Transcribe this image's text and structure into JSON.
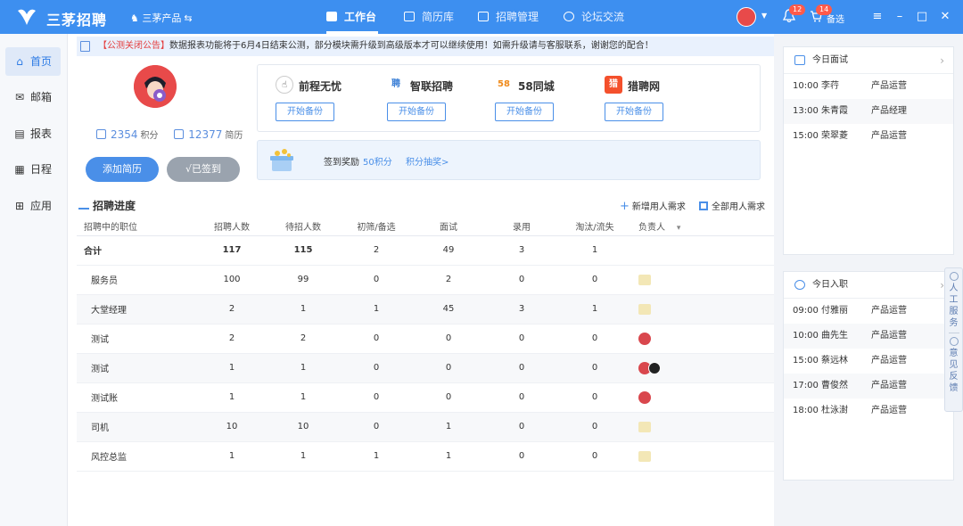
{
  "app": {
    "logo_text": "三茅招聘",
    "product_label": "三茅产品",
    "product_switch_icon": "switch-icon",
    "nav": [
      {
        "label": "工作台",
        "icon": "dashboard-icon",
        "active": true
      },
      {
        "label": "简历库",
        "icon": "resume-icon",
        "active": false
      },
      {
        "label": "招聘管理",
        "icon": "grid-icon",
        "active": false
      },
      {
        "label": "论坛交流",
        "icon": "chat-icon",
        "active": false
      }
    ],
    "bell_badge": "12",
    "cart_badge": "14",
    "cart_label": "备选",
    "colors": {
      "primary": "#3d8ff0",
      "accent": "#4a8fe8",
      "danger": "#e43c3c"
    }
  },
  "sidebar": {
    "items": [
      {
        "label": "首页",
        "icon": "home-icon"
      },
      {
        "label": "邮箱",
        "icon": "mail-icon"
      },
      {
        "label": "报表",
        "icon": "report-icon"
      },
      {
        "label": "日程",
        "icon": "calendar-icon"
      },
      {
        "label": "应用",
        "icon": "apps-icon"
      }
    ]
  },
  "notice": {
    "tag": "【公测关闭公告】",
    "text": "数据报表功能将于6月4日结束公测，部分模块需升级到高级版本才可以继续使用！如需升级请与客服联系，谢谢您的配合！"
  },
  "profile": {
    "points": "2354",
    "points_unit": "积分",
    "resumes": "12377",
    "resumes_unit": "简历",
    "add_button": "添加简历",
    "signed_button": "√已签到"
  },
  "partners": [
    {
      "name": "前程无忧",
      "logo": "51",
      "button": "开始备份"
    },
    {
      "name": "智联招聘",
      "logo": "聘",
      "button": "开始备份"
    },
    {
      "name": "58同城",
      "logo": "58",
      "button": "开始备份"
    },
    {
      "name": "猎聘网",
      "logo": "猎",
      "button": "开始备份"
    }
  ],
  "signin": {
    "label": "签到奖励",
    "points": "50积分",
    "link": "积分抽奖>"
  },
  "progress": {
    "title": "招聘进度",
    "add_demand": "新增用人需求",
    "all_demand": "全部用人需求",
    "columns": [
      "招聘中的职位",
      "招聘人数",
      "待招人数",
      "初筛/备选",
      "面试",
      "录用",
      "淘汰/流失",
      "负责人"
    ],
    "total": {
      "name": "合计",
      "values": [
        "117",
        "115",
        "2",
        "49",
        "3",
        "1"
      ]
    },
    "rows": [
      {
        "name": "服务员",
        "values": [
          "100",
          "99",
          "0",
          "2",
          "0",
          "0"
        ],
        "owner": "blank"
      },
      {
        "name": "大堂经理",
        "values": [
          "2",
          "1",
          "1",
          "45",
          "3",
          "1"
        ],
        "owner": "blank"
      },
      {
        "name": "测试",
        "values": [
          "2",
          "2",
          "0",
          "0",
          "0",
          "0"
        ],
        "owner": "red"
      },
      {
        "name": "测试",
        "values": [
          "1",
          "1",
          "0",
          "0",
          "0",
          "0"
        ],
        "owner": "pair"
      },
      {
        "name": "测试账",
        "values": [
          "1",
          "1",
          "0",
          "0",
          "0",
          "0"
        ],
        "owner": "red"
      },
      {
        "name": "司机",
        "values": [
          "10",
          "10",
          "0",
          "1",
          "0",
          "0"
        ],
        "owner": "blank"
      },
      {
        "name": "风控总监",
        "values": [
          "1",
          "1",
          "1",
          "1",
          "0",
          "0"
        ],
        "owner": "blank"
      }
    ]
  },
  "interviews": {
    "title": "今日面试",
    "rows": [
      {
        "time": "10:00",
        "name": "李荇",
        "role": "产品运营"
      },
      {
        "time": "13:00",
        "name": "朱青霞",
        "role": "产品经理"
      },
      {
        "time": "15:00",
        "name": "荣翠菱",
        "role": "产品运营"
      }
    ]
  },
  "onboarding": {
    "title": "今日入职",
    "rows": [
      {
        "time": "09:00",
        "name": "付雅丽",
        "role": "产品运营"
      },
      {
        "time": "10:00",
        "name": "曲先生",
        "role": "产品运营"
      },
      {
        "time": "15:00",
        "name": "蔡远林",
        "role": "产品运营"
      },
      {
        "time": "17:00",
        "name": "曹俊然",
        "role": "产品运营"
      },
      {
        "time": "18:00",
        "name": "杜泳澍",
        "role": "产品运营"
      }
    ]
  },
  "float_service": {
    "service_label": "人工服务",
    "feedback_label": "意见反馈"
  }
}
